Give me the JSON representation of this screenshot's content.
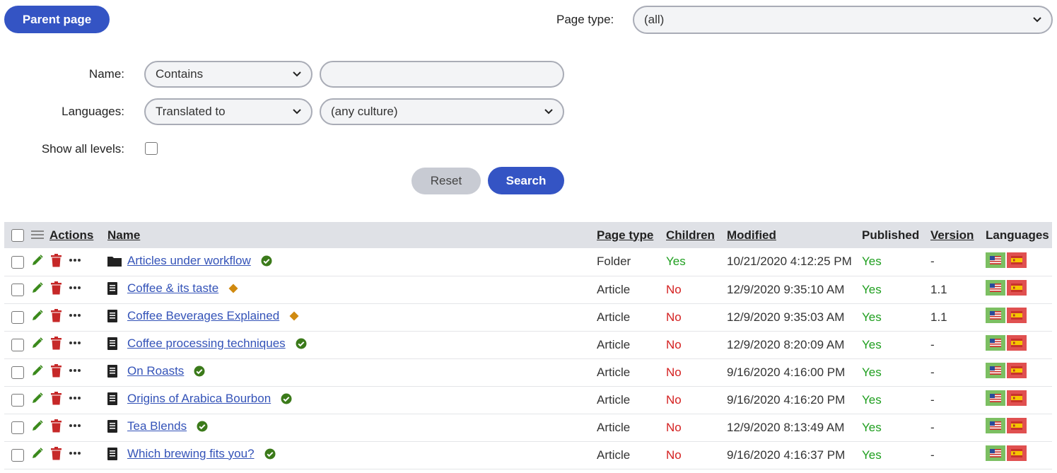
{
  "toolbar": {
    "parent_label": "Parent page"
  },
  "filters": {
    "page_type_label": "Page type:",
    "page_type_value": "(all)",
    "name_label": "Name:",
    "name_condition": "Contains",
    "name_value": "",
    "languages_label": "Languages:",
    "languages_condition": "Translated to",
    "languages_culture": "(any culture)",
    "show_levels_label": "Show all levels:",
    "reset_label": "Reset",
    "search_label": "Search"
  },
  "table": {
    "headers": {
      "actions": "Actions",
      "name": "Name",
      "page_type": "Page type",
      "children": "Children",
      "modified": "Modified",
      "published": "Published",
      "version": "Version",
      "languages": "Languages"
    },
    "rows": [
      {
        "icon": "folder-icon",
        "name": "Articles under workflow",
        "status": "published-check-icon",
        "page_type": "Folder",
        "children": "Yes",
        "modified": "10/21/2020 4:12:25 PM",
        "published": "Yes",
        "version": "-"
      },
      {
        "icon": "document-icon",
        "name": "Coffee & its taste",
        "status": "workflow-diamond-icon",
        "page_type": "Article",
        "children": "No",
        "modified": "12/9/2020 9:35:10 AM",
        "published": "Yes",
        "version": "1.1"
      },
      {
        "icon": "document-icon",
        "name": "Coffee Beverages Explained",
        "status": "workflow-diamond-icon",
        "page_type": "Article",
        "children": "No",
        "modified": "12/9/2020 9:35:03 AM",
        "published": "Yes",
        "version": "1.1"
      },
      {
        "icon": "document-icon",
        "name": "Coffee processing techniques",
        "status": "published-check-icon",
        "page_type": "Article",
        "children": "No",
        "modified": "12/9/2020 8:20:09 AM",
        "published": "Yes",
        "version": "-"
      },
      {
        "icon": "document-icon",
        "name": "On Roasts",
        "status": "published-check-icon",
        "page_type": "Article",
        "children": "No",
        "modified": "9/16/2020 4:16:00 PM",
        "published": "Yes",
        "version": "-"
      },
      {
        "icon": "document-icon",
        "name": "Origins of Arabica Bourbon",
        "status": "published-check-icon",
        "page_type": "Article",
        "children": "No",
        "modified": "9/16/2020 4:16:20 PM",
        "published": "Yes",
        "version": "-"
      },
      {
        "icon": "document-icon",
        "name": "Tea Blends",
        "status": "published-check-icon",
        "page_type": "Article",
        "children": "No",
        "modified": "12/9/2020 8:13:49 AM",
        "published": "Yes",
        "version": "-"
      },
      {
        "icon": "document-icon",
        "name": "Which brewing fits you?",
        "status": "published-check-icon",
        "page_type": "Article",
        "children": "No",
        "modified": "9/16/2020 4:16:37 PM",
        "published": "Yes",
        "version": "-"
      }
    ]
  },
  "colors": {
    "primary": "#3454c4",
    "yes": "#1e9e1e",
    "no": "#d42020",
    "edit": "#3b8a1c",
    "delete": "#c62828",
    "workflow": "#d08a10"
  }
}
